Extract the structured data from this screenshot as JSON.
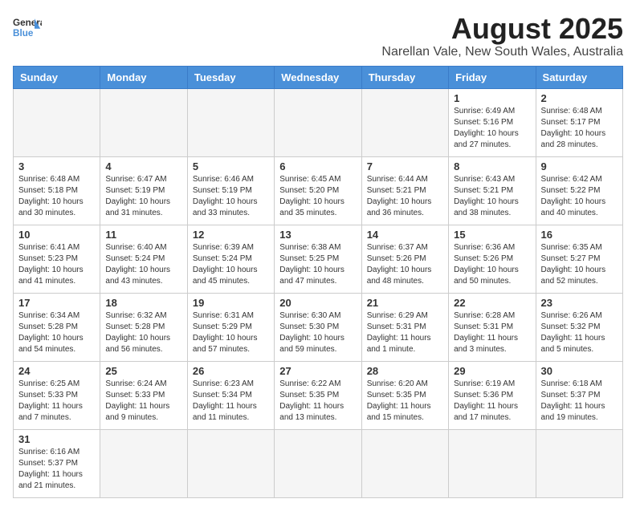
{
  "logo": {
    "general": "General",
    "blue": "Blue"
  },
  "title": "August 2025",
  "subtitle": "Narellan Vale, New South Wales, Australia",
  "days": [
    "Sunday",
    "Monday",
    "Tuesday",
    "Wednesday",
    "Thursday",
    "Friday",
    "Saturday"
  ],
  "weeks": [
    [
      {
        "day": "",
        "info": ""
      },
      {
        "day": "",
        "info": ""
      },
      {
        "day": "",
        "info": ""
      },
      {
        "day": "",
        "info": ""
      },
      {
        "day": "",
        "info": ""
      },
      {
        "day": "1",
        "info": "Sunrise: 6:49 AM\nSunset: 5:16 PM\nDaylight: 10 hours\nand 27 minutes."
      },
      {
        "day": "2",
        "info": "Sunrise: 6:48 AM\nSunset: 5:17 PM\nDaylight: 10 hours\nand 28 minutes."
      }
    ],
    [
      {
        "day": "3",
        "info": "Sunrise: 6:48 AM\nSunset: 5:18 PM\nDaylight: 10 hours\nand 30 minutes."
      },
      {
        "day": "4",
        "info": "Sunrise: 6:47 AM\nSunset: 5:19 PM\nDaylight: 10 hours\nand 31 minutes."
      },
      {
        "day": "5",
        "info": "Sunrise: 6:46 AM\nSunset: 5:19 PM\nDaylight: 10 hours\nand 33 minutes."
      },
      {
        "day": "6",
        "info": "Sunrise: 6:45 AM\nSunset: 5:20 PM\nDaylight: 10 hours\nand 35 minutes."
      },
      {
        "day": "7",
        "info": "Sunrise: 6:44 AM\nSunset: 5:21 PM\nDaylight: 10 hours\nand 36 minutes."
      },
      {
        "day": "8",
        "info": "Sunrise: 6:43 AM\nSunset: 5:21 PM\nDaylight: 10 hours\nand 38 minutes."
      },
      {
        "day": "9",
        "info": "Sunrise: 6:42 AM\nSunset: 5:22 PM\nDaylight: 10 hours\nand 40 minutes."
      }
    ],
    [
      {
        "day": "10",
        "info": "Sunrise: 6:41 AM\nSunset: 5:23 PM\nDaylight: 10 hours\nand 41 minutes."
      },
      {
        "day": "11",
        "info": "Sunrise: 6:40 AM\nSunset: 5:24 PM\nDaylight: 10 hours\nand 43 minutes."
      },
      {
        "day": "12",
        "info": "Sunrise: 6:39 AM\nSunset: 5:24 PM\nDaylight: 10 hours\nand 45 minutes."
      },
      {
        "day": "13",
        "info": "Sunrise: 6:38 AM\nSunset: 5:25 PM\nDaylight: 10 hours\nand 47 minutes."
      },
      {
        "day": "14",
        "info": "Sunrise: 6:37 AM\nSunset: 5:26 PM\nDaylight: 10 hours\nand 48 minutes."
      },
      {
        "day": "15",
        "info": "Sunrise: 6:36 AM\nSunset: 5:26 PM\nDaylight: 10 hours\nand 50 minutes."
      },
      {
        "day": "16",
        "info": "Sunrise: 6:35 AM\nSunset: 5:27 PM\nDaylight: 10 hours\nand 52 minutes."
      }
    ],
    [
      {
        "day": "17",
        "info": "Sunrise: 6:34 AM\nSunset: 5:28 PM\nDaylight: 10 hours\nand 54 minutes."
      },
      {
        "day": "18",
        "info": "Sunrise: 6:32 AM\nSunset: 5:28 PM\nDaylight: 10 hours\nand 56 minutes."
      },
      {
        "day": "19",
        "info": "Sunrise: 6:31 AM\nSunset: 5:29 PM\nDaylight: 10 hours\nand 57 minutes."
      },
      {
        "day": "20",
        "info": "Sunrise: 6:30 AM\nSunset: 5:30 PM\nDaylight: 10 hours\nand 59 minutes."
      },
      {
        "day": "21",
        "info": "Sunrise: 6:29 AM\nSunset: 5:31 PM\nDaylight: 11 hours\nand 1 minute."
      },
      {
        "day": "22",
        "info": "Sunrise: 6:28 AM\nSunset: 5:31 PM\nDaylight: 11 hours\nand 3 minutes."
      },
      {
        "day": "23",
        "info": "Sunrise: 6:26 AM\nSunset: 5:32 PM\nDaylight: 11 hours\nand 5 minutes."
      }
    ],
    [
      {
        "day": "24",
        "info": "Sunrise: 6:25 AM\nSunset: 5:33 PM\nDaylight: 11 hours\nand 7 minutes."
      },
      {
        "day": "25",
        "info": "Sunrise: 6:24 AM\nSunset: 5:33 PM\nDaylight: 11 hours\nand 9 minutes."
      },
      {
        "day": "26",
        "info": "Sunrise: 6:23 AM\nSunset: 5:34 PM\nDaylight: 11 hours\nand 11 minutes."
      },
      {
        "day": "27",
        "info": "Sunrise: 6:22 AM\nSunset: 5:35 PM\nDaylight: 11 hours\nand 13 minutes."
      },
      {
        "day": "28",
        "info": "Sunrise: 6:20 AM\nSunset: 5:35 PM\nDaylight: 11 hours\nand 15 minutes."
      },
      {
        "day": "29",
        "info": "Sunrise: 6:19 AM\nSunset: 5:36 PM\nDaylight: 11 hours\nand 17 minutes."
      },
      {
        "day": "30",
        "info": "Sunrise: 6:18 AM\nSunset: 5:37 PM\nDaylight: 11 hours\nand 19 minutes."
      }
    ],
    [
      {
        "day": "31",
        "info": "Sunrise: 6:16 AM\nSunset: 5:37 PM\nDaylight: 11 hours\nand 21 minutes."
      },
      {
        "day": "",
        "info": ""
      },
      {
        "day": "",
        "info": ""
      },
      {
        "day": "",
        "info": ""
      },
      {
        "day": "",
        "info": ""
      },
      {
        "day": "",
        "info": ""
      },
      {
        "day": "",
        "info": ""
      }
    ]
  ]
}
